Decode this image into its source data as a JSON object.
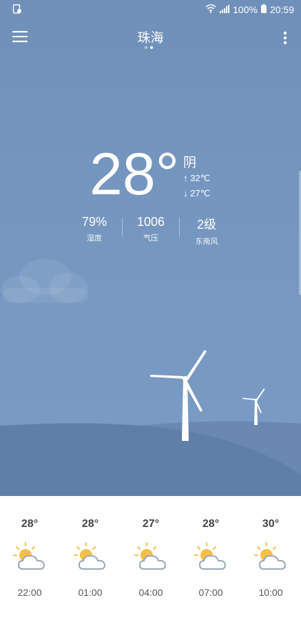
{
  "status_bar": {
    "battery": "100%",
    "time": "20:59"
  },
  "header": {
    "city": "珠海",
    "page_count": 2,
    "active_page": 2
  },
  "current": {
    "temperature": "28°",
    "condition": "阴",
    "high": "32℃",
    "low": "27℃",
    "high_icon": "arrow-up-icon",
    "low_icon": "arrow-down-icon"
  },
  "stats": [
    {
      "value": "79%",
      "label": "湿度"
    },
    {
      "value": "1006",
      "label": "气压"
    },
    {
      "value": "2级",
      "label": "东南风"
    }
  ],
  "forecast": [
    {
      "temp": "28°",
      "time": "22:00",
      "icon": "partly-cloudy-icon"
    },
    {
      "temp": "28°",
      "time": "01:00",
      "icon": "partly-cloudy-icon"
    },
    {
      "temp": "27°",
      "time": "04:00",
      "icon": "partly-cloudy-icon"
    },
    {
      "temp": "28°",
      "time": "07:00",
      "icon": "partly-cloudy-icon"
    },
    {
      "temp": "30°",
      "time": "10:00",
      "icon": "partly-cloudy-icon"
    }
  ],
  "colors": {
    "sky": "#7596bf",
    "hill_back": "#6a88b1",
    "hill_front": "#5f7ea8",
    "sun": "#f5c04a",
    "cloud_outline": "#9aa7b4"
  }
}
